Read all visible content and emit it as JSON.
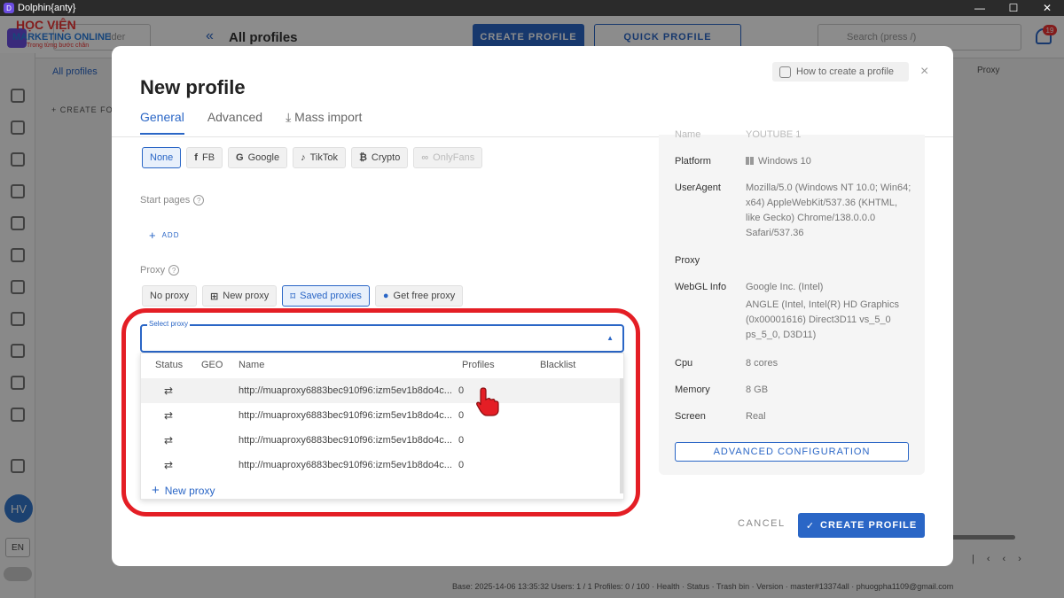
{
  "window": {
    "title": "Dolphin{anty}"
  },
  "background": {
    "brand_line1": "HỌC VIỆN",
    "brand_line2": "MARKETING ONLINE",
    "brand_line3": "Trong từng bước chân",
    "folder_placeholder": "lder",
    "page_title": "All profiles",
    "create_profile": "CREATE PROFILE",
    "quick_profile": "QUICK PROFILE",
    "search_placeholder": "Search (press /)",
    "notification_count": "19",
    "all_profiles_tab": "All profiles",
    "create_folder": "+ CREATE FO",
    "proxy_column": "Proxy",
    "avatar": "HV",
    "language": "EN",
    "statusbar": "Base: 2025-14-06 13:35:32  Users: 1 / 1  Profiles: 0 / 100  ·  Health  ·  Status  ·  Trash bin  ·  Version  ·  master#13374all  ·  phuogpha1109@gmail.com"
  },
  "modal": {
    "title": "New profile",
    "help": "How to create a profile",
    "close": "×",
    "tabs": [
      {
        "label": "General"
      },
      {
        "label": "Advanced"
      },
      {
        "label": "Mass import"
      }
    ],
    "platform_chips": [
      "None",
      "FB",
      "Google",
      "TikTok",
      "Crypto",
      "OnlyFans"
    ],
    "start_pages_label": "Start pages",
    "add_label": "ADD",
    "proxy_label": "Proxy",
    "proxy_chips": [
      "No proxy",
      "New proxy",
      "Saved proxies",
      "Get free proxy"
    ],
    "select_proxy_label": "Select proxy",
    "proxy_table": {
      "headers": [
        "Status",
        "GEO",
        "Name",
        "Profiles",
        "Blacklist"
      ],
      "rows": [
        {
          "status": "⇄",
          "geo": "",
          "name": "http://muaproxy6883bec910f96:izm5ev1b8do4c...",
          "profiles": "0",
          "blacklist": ""
        },
        {
          "status": "⇄",
          "geo": "",
          "name": "http://muaproxy6883bec910f96:izm5ev1b8do4c...",
          "profiles": "0",
          "blacklist": ""
        },
        {
          "status": "⇄",
          "geo": "",
          "name": "http://muaproxy6883bec910f96:izm5ev1b8do4c...",
          "profiles": "0",
          "blacklist": ""
        },
        {
          "status": "⇄",
          "geo": "",
          "name": "http://muaproxy6883bec910f96:izm5ev1b8do4c...",
          "profiles": "0",
          "blacklist": ""
        }
      ],
      "new_proxy": "New proxy"
    },
    "summary": {
      "name_label": "Name",
      "name_value": "YOUTUBE 1",
      "platform_label": "Platform",
      "platform_value": "Windows 10",
      "useragent_label": "UserAgent",
      "useragent_value": "Mozilla/5.0 (Windows NT 10.0; Win64; x64) AppleWebKit/537.36 (KHTML, like Gecko) Chrome/138.0.0.0 Safari/537.36",
      "proxy_label": "Proxy",
      "proxy_value": "",
      "webgl_label": "WebGL Info",
      "webgl_vendor": "Google Inc. (Intel)",
      "webgl_renderer": "ANGLE (Intel, Intel(R) HD Graphics (0x00001616) Direct3D11 vs_5_0 ps_5_0, D3D11)",
      "cpu_label": "Cpu",
      "cpu_value": "8 cores",
      "memory_label": "Memory",
      "memory_value": "8 GB",
      "screen_label": "Screen",
      "screen_value": "Real",
      "advanced_button": "ADVANCED CONFIGURATION"
    },
    "cancel": "CANCEL",
    "create": "CREATE PROFILE"
  },
  "colors": {
    "accent": "#2a66c6",
    "highlight": "#e41e25"
  }
}
